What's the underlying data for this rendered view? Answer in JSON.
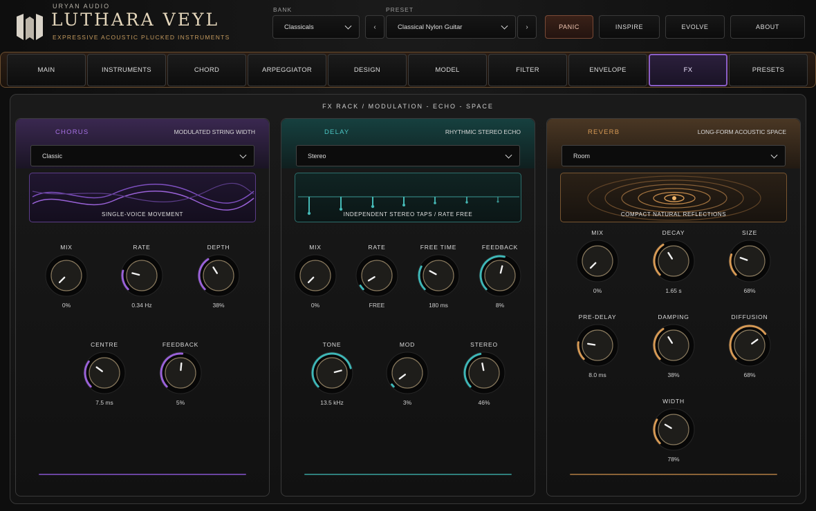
{
  "header": {
    "company": "URYAN AUDIO",
    "title": "LUTHARA VEYL",
    "tagline": "EXPRESSIVE ACOUSTIC PLUCKED INSTRUMENTS",
    "bank_label": "BANK",
    "bank_value": "Classicals",
    "preset_label": "PRESET",
    "preset_value": "Classical Nylon Guitar",
    "prev_label": "‹",
    "next_label": "›",
    "buttons": [
      "PANIC",
      "INSPIRE",
      "EVOLVE",
      "ABOUT"
    ]
  },
  "tabs": [
    "MAIN",
    "INSTRUMENTS",
    "CHORD",
    "ARPEGGIATOR",
    "DESIGN",
    "MODEL",
    "FILTER",
    "ENVELOPE",
    "FX",
    "PRESETS"
  ],
  "active_tab": "FX",
  "rack_title": "FX RACK  /  MODULATION  -  ECHO  -  SPACE",
  "panels": {
    "chorus": {
      "name": "CHORUS",
      "description": "MODULATED STRING WIDTH",
      "mode": "Classic",
      "caption": "SINGLE-VOICE MOVEMENT",
      "accent": "#9a62d8",
      "knobs": [
        {
          "label": "MIX",
          "value": "0%",
          "level": 0.0
        },
        {
          "label": "RATE",
          "value": "0.34 Hz",
          "level": 0.22
        },
        {
          "label": "DEPTH",
          "value": "38%",
          "level": 0.38
        },
        {
          "label": "CENTRE",
          "value": "7.5 ms",
          "level": 0.3
        },
        {
          "label": "FEEDBACK",
          "value": "5%",
          "level": 0.52
        }
      ]
    },
    "delay": {
      "name": "DELAY",
      "description": "RHYTHMIC STEREO ECHO",
      "mode": "Stereo",
      "caption": "INDEPENDENT STEREO TAPS  /  RATE FREE",
      "accent": "#3fb7b7",
      "knobs": [
        {
          "label": "MIX",
          "value": "0%",
          "level": 0.0
        },
        {
          "label": "RATE",
          "value": "FREE",
          "level": 0.05
        },
        {
          "label": "FREE TIME",
          "value": "180 ms",
          "level": 0.27
        },
        {
          "label": "FEEDBACK",
          "value": "8%",
          "level": 0.55
        },
        {
          "label": "TONE",
          "value": "13.5 kHz",
          "level": 0.78
        },
        {
          "label": "MOD",
          "value": "3%",
          "level": 0.03
        },
        {
          "label": "STEREO",
          "value": "46%",
          "level": 0.46
        }
      ]
    },
    "reverb": {
      "name": "REVERB",
      "description": "LONG-FORM ACOUSTIC SPACE",
      "mode": "Room",
      "caption": "COMPACT NATURAL REFLECTIONS",
      "accent": "#d79a55",
      "knobs": [
        {
          "label": "MIX",
          "value": "0%",
          "level": 0.0
        },
        {
          "label": "DECAY",
          "value": "1.65 s",
          "level": 0.38
        },
        {
          "label": "SIZE",
          "value": "68%",
          "level": 0.24
        },
        {
          "label": "PRE-DELAY",
          "value": "8.0 ms",
          "level": 0.2
        },
        {
          "label": "DAMPING",
          "value": "38%",
          "level": 0.38
        },
        {
          "label": "DIFFUSION",
          "value": "68%",
          "level": 0.7
        },
        {
          "label": "WIDTH",
          "value": "78%",
          "level": 0.28
        }
      ]
    }
  }
}
